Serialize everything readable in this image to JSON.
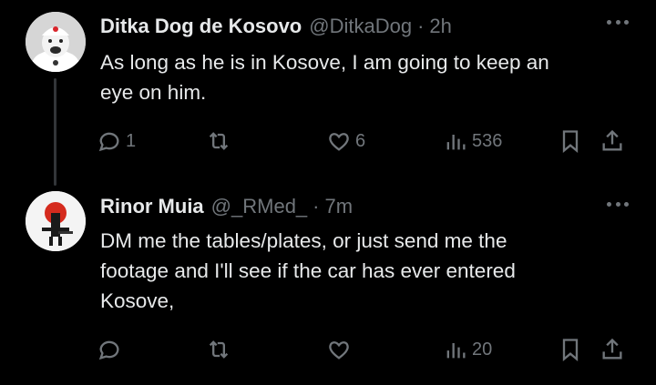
{
  "tweets": [
    {
      "name": "Ditka Dog de Kosovo",
      "handle": "@DitkaDog",
      "separator": "·",
      "time": "2h",
      "lines": [
        "As long as he is in Kosove, I am going to keep an",
        "eye on him."
      ],
      "replies": "1",
      "retweets": "",
      "likes": "6",
      "views": "536"
    },
    {
      "name": "Rinor Muia",
      "handle": "@_RMed_",
      "separator": "·",
      "time": "7m",
      "lines": [
        "DM me the tables/plates, or just send me the",
        "footage and I'll see if the car has ever entered",
        "Kosove,"
      ],
      "replies": "",
      "retweets": "",
      "likes": "",
      "views": "20"
    }
  ],
  "icons": [
    "reply-icon",
    "retweet-icon",
    "like-icon",
    "views-icon",
    "bookmark-icon",
    "share-icon",
    "more-icon"
  ],
  "colors": {
    "background": "#000000",
    "text": "#e7e9ea",
    "muted": "#71767b",
    "thread_line": "#333639"
  }
}
